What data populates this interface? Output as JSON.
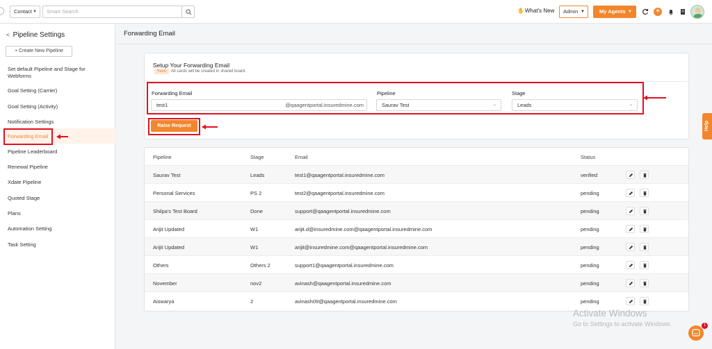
{
  "topbar": {
    "contact_label": "Contact",
    "search_placeholder": "Smart Search",
    "whats_new": "What's New",
    "admin_label": "Admin",
    "my_agents_label": "My Agents"
  },
  "sidebar": {
    "title": "Pipeline Settings",
    "create_button": "+ Create New Pipeline",
    "items": [
      "Set default Pipeline and Stage for",
      "Webforms",
      "Goal Setting (Carrier)",
      "Goal Setting (Activity)",
      "Notification Settings",
      "Forwarding Email",
      "Pipeline Leaderboard",
      "Renewal Pipeline",
      "Xdate Pipeline",
      "Quoted Stage",
      "Plans",
      "Automation Setting",
      "Task Setting"
    ]
  },
  "main": {
    "title": "Forwarding Email",
    "setup": {
      "title": "Setup Your Forwarding Email",
      "note_badge": "*Note:",
      "note_text": "All cards will be created in shared board.",
      "forwarding_label": "Forwarding Email",
      "forwarding_value": "test1",
      "forwarding_domain": "@qaagentportal.insuredmine.com",
      "pipeline_label": "Pipeline",
      "pipeline_value": "Saurav Test",
      "stage_label": "Stage",
      "stage_value": "Leads",
      "raise_button": "Raise Request"
    },
    "table": {
      "headers": [
        "Pipeline",
        "Stage",
        "Email",
        "Status"
      ],
      "rows": [
        {
          "pipeline": "Saurav Test",
          "stage": "Leads",
          "email": "test1@qaagentportal.insuredmine.com",
          "status": "verified"
        },
        {
          "pipeline": "Personal Services",
          "stage": "PS 2",
          "email": "test2@qaagentportal.insuredmine.com",
          "status": "pending"
        },
        {
          "pipeline": "Shilpa's Test Board",
          "stage": "Done",
          "email": "support@qaagentportal.insuredmine.com",
          "status": "pending"
        },
        {
          "pipeline": "Arijit Updated",
          "stage": "W1",
          "email": "arijit.d@insuredmine.com@qaagentportal.insuredmine.com",
          "status": "pending"
        },
        {
          "pipeline": "Arijit Updated",
          "stage": "W1",
          "email": "arijit@insuredmine.com@qaagentportal.insuredmine.com",
          "status": "pending"
        },
        {
          "pipeline": "Others",
          "stage": "Others 2",
          "email": "support1@qaagentportal.insuredmine.com",
          "status": "pending"
        },
        {
          "pipeline": "November",
          "stage": "nov2",
          "email": "avinash@qaagentportal.insuredmine.com",
          "status": "pending"
        },
        {
          "pipeline": "Aiswarya",
          "stage": "2",
          "email": "avinash09@qaagentportal.insuredmine.com",
          "status": "pending"
        }
      ]
    }
  },
  "help_tab": "Help",
  "watermark": {
    "line1": "Activate Windows",
    "line2": "Go to Settings to activate Windows."
  },
  "chat_badge": "1",
  "colors": {
    "accent": "#f2862d",
    "annotation_red": "#e0101e"
  }
}
